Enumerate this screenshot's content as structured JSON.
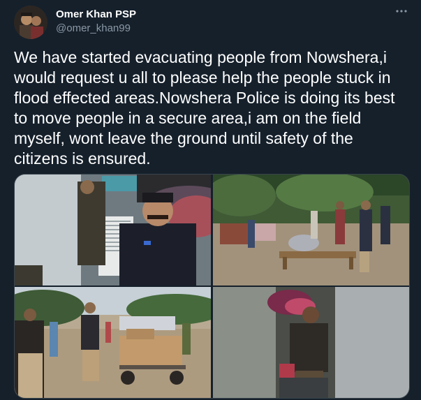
{
  "author": {
    "display_name": "Omer Khan PSP",
    "handle": "@omer_khan99"
  },
  "tweet": {
    "text": "We have started evacuating people from Nowshera,i would request u all to please help the people stuck in flood effected areas.Nowshera Police is doing its best to move people in a secure area,i am on the field myself, wont leave the ground until safety of the citizens is ensured."
  },
  "icons": {
    "more": "more-horizontal-icon"
  },
  "colors": {
    "background": "#15202b",
    "text": "#ffffff",
    "secondary_text": "#8b98a5",
    "border": "#38444d"
  }
}
